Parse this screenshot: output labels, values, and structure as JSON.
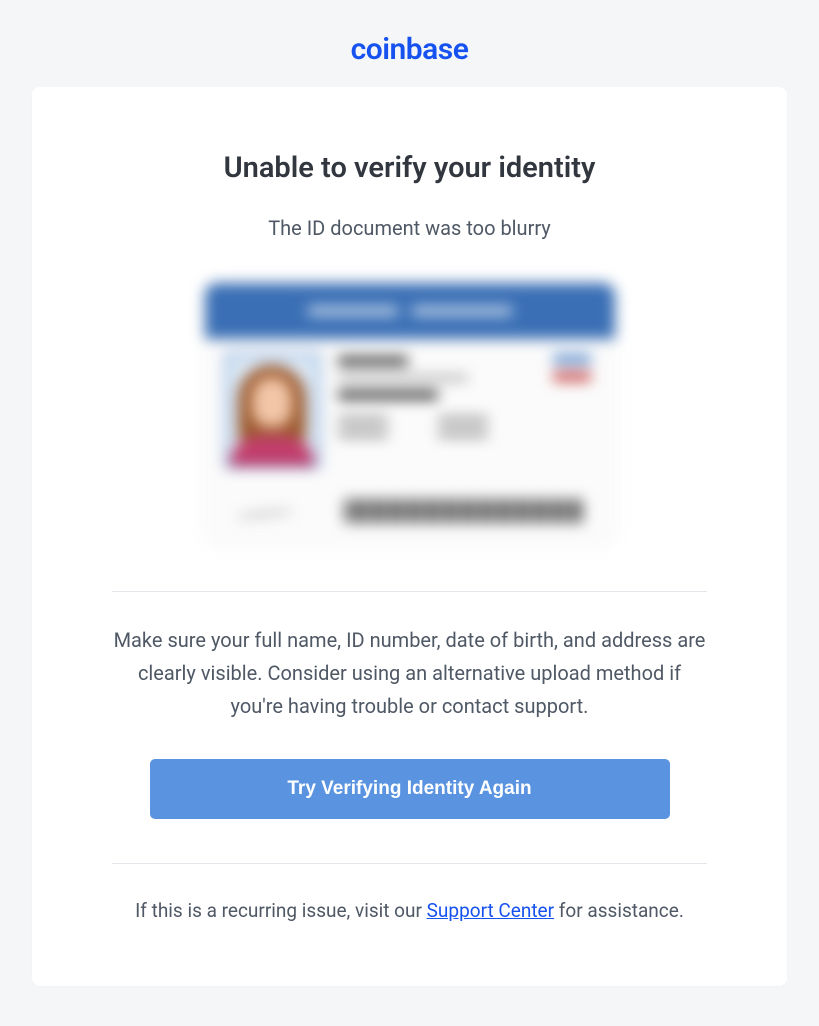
{
  "brand": {
    "name": "coinbase"
  },
  "main": {
    "title": "Unable to verify your identity",
    "subtitle": "The ID document was too blurry",
    "instructions": "Make sure your full name, ID number, date of birth, and address are clearly visible. Consider using an alternative upload method if you're having trouble or contact support.",
    "cta_label": "Try Verifying Identity Again",
    "footer_prefix": "If this is a recurring issue, visit our ",
    "footer_link_label": "Support Center",
    "footer_suffix": " for assistance."
  }
}
